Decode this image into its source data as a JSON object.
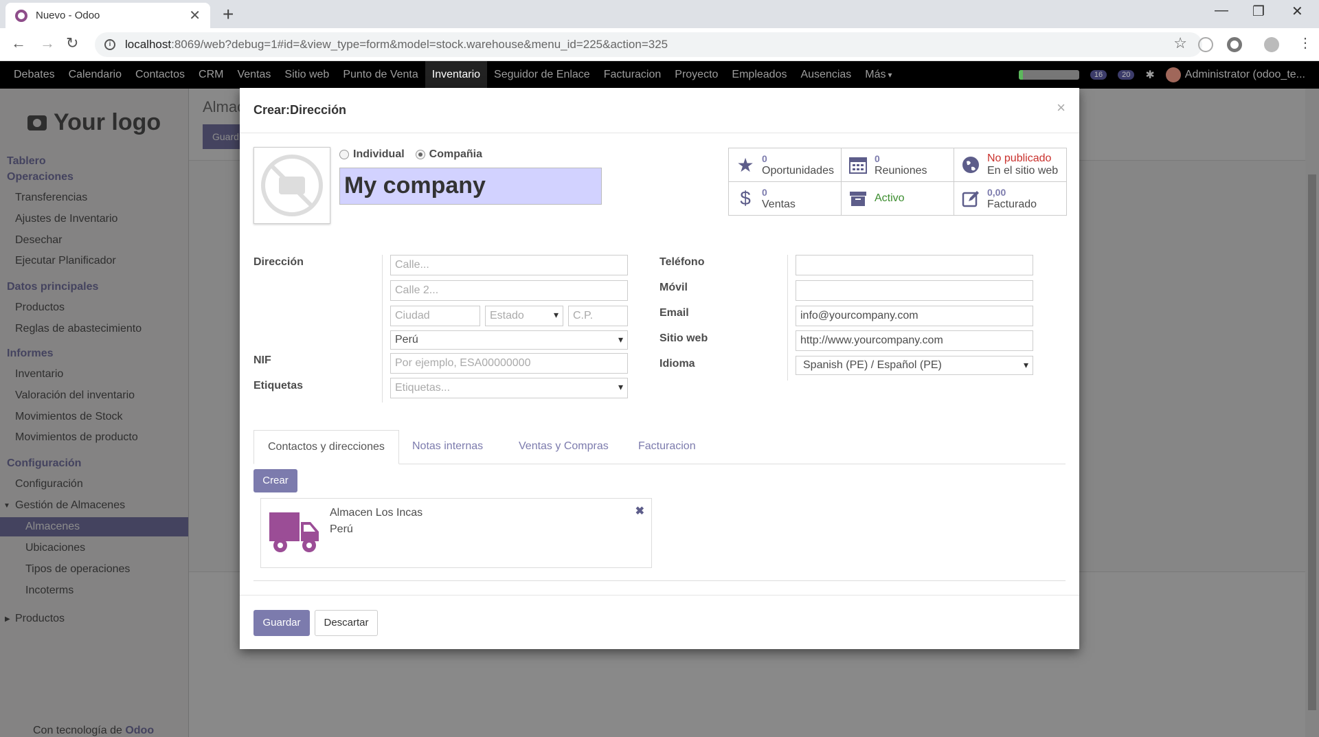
{
  "browser": {
    "tab_title": "Nuevo - Odoo",
    "url_host": "localhost",
    "url_rest": ":8069/web?debug=1#id=&view_type=form&model=stock.warehouse&menu_id=225&action=325"
  },
  "topmenu": {
    "items": [
      "Debates",
      "Calendario",
      "Contactos",
      "CRM",
      "Ventas",
      "Sitio web",
      "Punto de Venta",
      "Inventario",
      "Seguidor de Enlace",
      "Facturacion",
      "Proyecto",
      "Empleados",
      "Ausencias",
      "Más"
    ],
    "active": "Inventario",
    "badge_messages": "16",
    "badge_chat": "20",
    "user": "Administrator (odoo_te..."
  },
  "sidebar": {
    "logo": "Your logo",
    "tablero": "Tablero",
    "operaciones": "Operaciones",
    "op_items": [
      "Transferencias",
      "Ajustes de Inventario",
      "Desechar",
      "Ejecutar Planificador"
    ],
    "datos": "Datos principales",
    "datos_items": [
      "Productos",
      "Reglas de abastecimiento"
    ],
    "informes": "Informes",
    "inf_items": [
      "Inventario",
      "Valoración del inventario",
      "Movimientos de Stock",
      "Movimientos de producto"
    ],
    "config": "Configuración",
    "config_item": "Configuración",
    "gestion": "Gestión de Almacenes",
    "gestion_items": [
      "Almacenes",
      "Ubicaciones",
      "Tipos de operaciones",
      "Incoterms"
    ],
    "productos": "Productos",
    "footer_pre": "Con tecnología de ",
    "footer_brand": "Odoo"
  },
  "background": {
    "title": "Almac",
    "save": "Guard"
  },
  "modal": {
    "title": "Crear:Dirección",
    "close": "×",
    "radio_individual": "Individual",
    "radio_company": "Compañia",
    "name": "My company",
    "stats": {
      "opp_num": "0",
      "opp_label": "Oportunidades",
      "meet_num": "0",
      "meet_label": "Reuniones",
      "web_status": "No publicado",
      "web_label": "En el sitio web",
      "sales_num": "0",
      "sales_label": "Ventas",
      "active_label": "Activo",
      "invoiced_num": "0,00",
      "invoiced_label": "Facturado"
    },
    "labels": {
      "direccion": "Dirección",
      "nif": "NIF",
      "etiquetas": "Etiquetas",
      "telefono": "Teléfono",
      "movil": "Móvil",
      "email": "Email",
      "sitio": "Sitio web",
      "idioma": "Idioma"
    },
    "fields": {
      "calle_ph": "Calle...",
      "calle2_ph": "Calle 2...",
      "ciudad_ph": "Ciudad",
      "estado_ph": "Estado",
      "cp_ph": "C.P.",
      "pais": "Perú",
      "nif_ph": "Por ejemplo, ESA00000000",
      "etiquetas_ph": "Etiquetas...",
      "telefono": "",
      "movil": "",
      "email": "info@yourcompany.com",
      "sitio": "http://www.yourcompany.com",
      "idioma": "Spanish (PE) / Español (PE)"
    },
    "tabs": [
      "Contactos y direcciones",
      "Notas internas",
      "Ventas y Compras",
      "Facturacion"
    ],
    "create_btn": "Crear",
    "card": {
      "name": "Almacen Los Incas",
      "country": "Perú"
    },
    "save_btn": "Guardar",
    "discard_btn": "Descartar"
  }
}
